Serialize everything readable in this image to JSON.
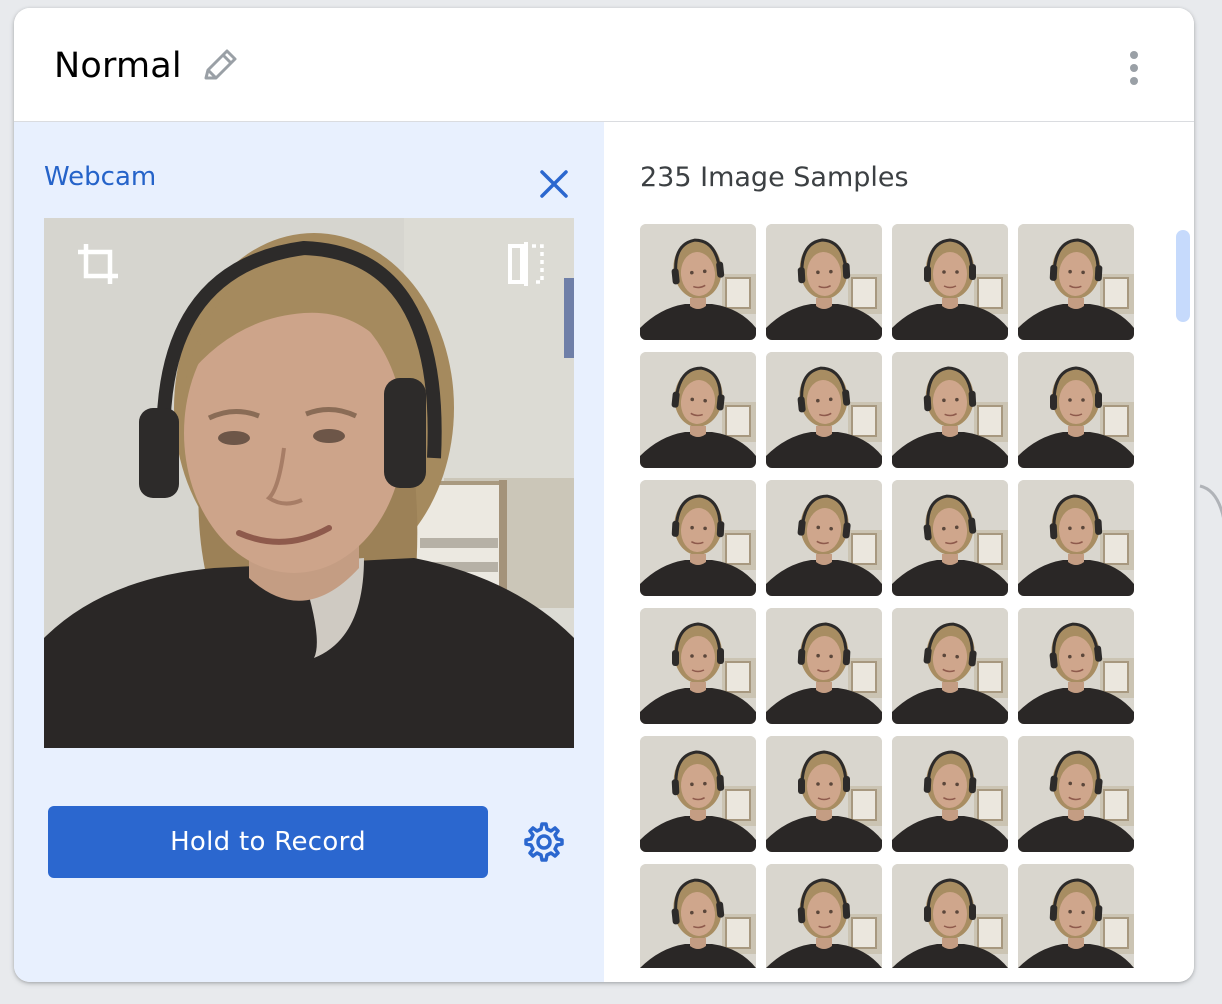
{
  "class_card": {
    "name": "Normal",
    "edit_icon": "pencil-icon",
    "menu_icon": "more-vert-icon"
  },
  "webcam": {
    "title": "Webcam",
    "close_icon": "close-icon",
    "crop_icon": "crop-icon",
    "flip_icon": "flip-icon",
    "record_label": "Hold to Record",
    "settings_icon": "gear-icon"
  },
  "samples": {
    "title": "235 Image Samples",
    "count": 235,
    "visible_rows": 6,
    "columns": 4
  },
  "colors": {
    "accent": "#2b67cf",
    "panel_bg": "#e8f0fe",
    "title_blue": "#2563c9",
    "scroll_thumb": "#c6dafc"
  }
}
